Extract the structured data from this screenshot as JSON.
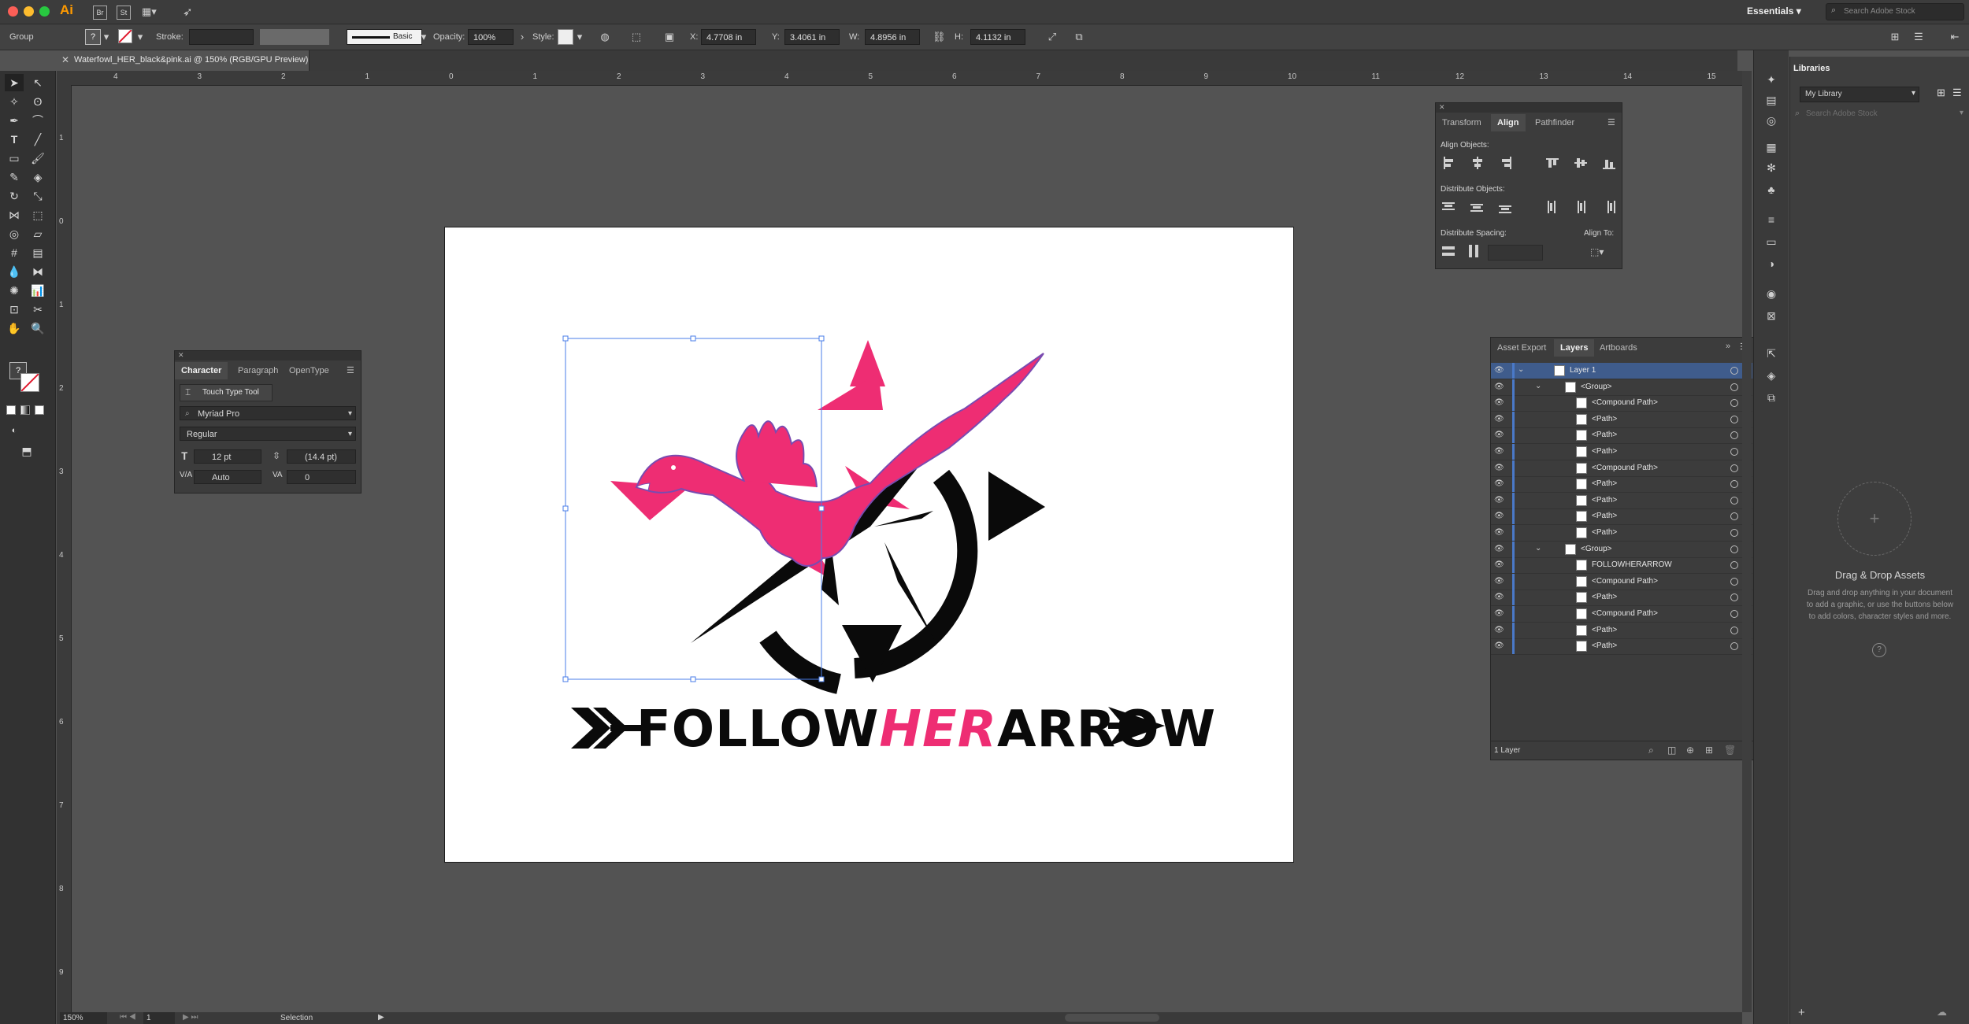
{
  "app": {
    "logo": "Ai",
    "workspace": "Essentials",
    "search_stock_placeholder": "Search Adobe Stock"
  },
  "control_bar": {
    "selection_type": "Group",
    "stroke_label": "Stroke:",
    "brush_style": "Basic",
    "opacity_label": "Opacity:",
    "opacity_value": "100%",
    "style_label": "Style:",
    "x_label": "X:",
    "x_value": "4.7708 in",
    "y_label": "Y:",
    "y_value": "3.4061 in",
    "w_label": "W:",
    "w_value": "4.8956 in",
    "h_label": "H:",
    "h_value": "4.1132 in"
  },
  "document": {
    "tab_title": "Waterfowl_HER_black&pink.ai @ 150% (RGB/GPU Preview)"
  },
  "ruler_h": [
    "4",
    "3",
    "2",
    "1",
    "0",
    "1",
    "2",
    "3",
    "4",
    "5",
    "6",
    "7",
    "8",
    "9",
    "10",
    "11",
    "12",
    "13",
    "14",
    "15"
  ],
  "ruler_v": [
    "1",
    "0",
    "1",
    "2",
    "3",
    "4",
    "5",
    "6",
    "7",
    "8",
    "9"
  ],
  "artwork": {
    "brand_pre": "FOLLOW",
    "brand_her": "HER",
    "brand_post": "ARROW",
    "pink": "#ee2d73",
    "black": "#0a0a0a"
  },
  "character_panel": {
    "tabs": [
      "Character",
      "Paragraph",
      "OpenType"
    ],
    "touch_type_tool": "Touch Type Tool",
    "font_family": "Myriad Pro",
    "font_style": "Regular",
    "font_size": "12 pt",
    "leading": "(14.4 pt)",
    "kerning": "Auto",
    "tracking": "0"
  },
  "align_panel": {
    "tabs": [
      "Transform",
      "Align",
      "Pathfinder"
    ],
    "align_objects": "Align Objects:",
    "distribute_objects": "Distribute Objects:",
    "distribute_spacing": "Distribute Spacing:",
    "align_to": "Align To:"
  },
  "layers_panel": {
    "tabs": [
      "Asset Export",
      "Layers",
      "Artboards"
    ],
    "footer": "1 Layer",
    "rows": [
      {
        "label": "Layer 1",
        "indent": 0
      },
      {
        "label": "<Group>",
        "indent": 1
      },
      {
        "label": "<Compound Path>",
        "indent": 2
      },
      {
        "label": "<Path>",
        "indent": 2
      },
      {
        "label": "<Path>",
        "indent": 2
      },
      {
        "label": "<Path>",
        "indent": 2
      },
      {
        "label": "<Compound Path>",
        "indent": 2
      },
      {
        "label": "<Path>",
        "indent": 2
      },
      {
        "label": "<Path>",
        "indent": 2
      },
      {
        "label": "<Path>",
        "indent": 2
      },
      {
        "label": "<Path>",
        "indent": 2
      },
      {
        "label": "<Group>",
        "indent": 1
      },
      {
        "label": "FOLLOWHERARROW",
        "indent": 2
      },
      {
        "label": "<Compound Path>",
        "indent": 2
      },
      {
        "label": "<Path>",
        "indent": 2
      },
      {
        "label": "<Compound Path>",
        "indent": 2
      },
      {
        "label": "<Path>",
        "indent": 2
      },
      {
        "label": "<Path>",
        "indent": 2
      }
    ]
  },
  "libraries_panel": {
    "title": "Libraries",
    "library_name": "My Library",
    "search_placeholder": "Search Adobe Stock",
    "drop_title": "Drag & Drop Assets",
    "drop_desc": "Drag and drop anything in your document to add a graphic, or use the buttons below to add colors, character styles and more."
  },
  "status_bar": {
    "zoom": "150%",
    "artboard_num": "1",
    "tool": "Selection"
  }
}
